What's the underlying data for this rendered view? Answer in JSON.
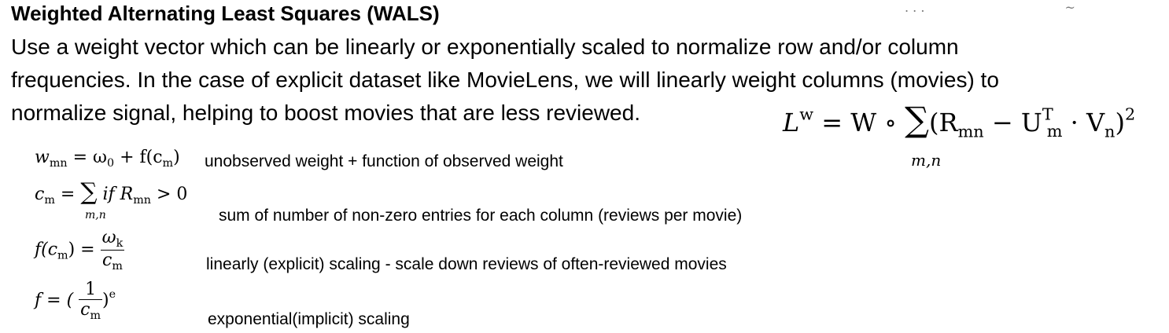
{
  "title": "Weighted Alternating Least Squares (WALS)",
  "paragraph": [
    "Use a weight vector which can be linearly or exponentially scaled to normalize row and/or column",
    "frequencies. In the case of explicit dataset like MovieLens, we will linearly weight columns (movies) to",
    "normalize signal, helping to boost movies that are less reviewed."
  ],
  "equations": {
    "loss": {
      "lhs": "L",
      "lhs_sup": "w",
      "rhs_pre": "= W ∘ ",
      "sum": "∑",
      "sum_sub": "m,n",
      "body": "(R",
      "body_sub": "mn",
      "body_mid": " − U",
      "u_sup": "T",
      "u_sub": "m",
      "body_mid2": " · V",
      "v_sub": "n",
      "body_end": ")",
      "power": "2"
    },
    "weight": {
      "w": "w",
      "w_sub": "mn",
      "eq": " = ω",
      "omega_sub": "0",
      "rest": " + f(c",
      "c_sub": "m",
      "close": ")",
      "description": "unobserved weight + function of observed weight"
    },
    "count": {
      "c": "c",
      "c_sub": "m",
      "eq": " = ",
      "sum": "∑",
      "sum_sub": "m,n",
      "cond": " if R",
      "r_sub": "mn",
      "gt": " > 0",
      "description": "sum of number of non-zero entries for each column (reviews per movie)"
    },
    "linear": {
      "lhs": "f(c",
      "lhs_sub": "m",
      "lhs_close": ") = ",
      "num": "ω",
      "num_sub": "k",
      "den": "c",
      "den_sub": "m",
      "description": "linearly (explicit) scaling - scale down reviews of often-reviewed movies"
    },
    "exponential": {
      "lhs": "f = (",
      "num": "1",
      "den": "c",
      "den_sub": "m",
      "close": ")",
      "power": "e",
      "description": "exponential(implicit) scaling"
    }
  }
}
